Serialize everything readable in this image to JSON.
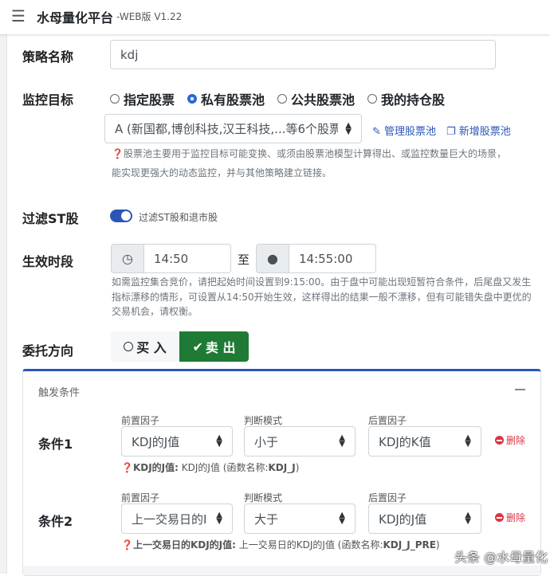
{
  "header": {
    "title": "水母量化平台",
    "version": "-WEB版 V1.22"
  },
  "form": {
    "name_label": "策略名称",
    "name_value": "kdj",
    "target_label": "监控目标",
    "target_options": [
      "指定股票",
      "私有股票池",
      "公共股票池",
      "我的持仓股"
    ],
    "target_selected": 1,
    "pool_select": "A (新国都,博创科技,汉王科技,...等6个股票",
    "manage_pool": "管理股票池",
    "new_pool": "新增股票池",
    "pool_help": [
      "股票池主要用于监控目标可能变换、或须由股票池模型计算得出、或监控数量巨大的场景，",
      "能实现更强大的动态监控，并与其他策略建立链接。"
    ],
    "st_label": "过滤ST股",
    "st_toggle_text": "过滤ST股和退市股",
    "st_on": true,
    "time_label": "生效时段",
    "time_start": "14:50",
    "time_sep": "至",
    "time_end": "14:55:00",
    "time_help": "如需监控集合竞价，请把起始时间设置到9:15:00。由于盘中可能出现短暂符合条件，后尾盘又发生指标漂移的情形，可设置从14:50开始生效，这样得出的结果一般不漂移，但有可能错失盘中更优的交易机会，请权衡。",
    "direction_label": "委托方向",
    "buy": "买 入",
    "sell": "卖 出",
    "direction_selected": "sell"
  },
  "trigger": {
    "title": "触发条件",
    "col_labels": [
      "前置因子",
      "判断模式",
      "后置因子"
    ],
    "delete_label": "删除",
    "conditions": [
      {
        "label": "条件1",
        "front": "KDJ的J值",
        "mode": "小于",
        "back": "KDJ的K值",
        "help_bold": "KDJ的J值:",
        "help_text": " KDJ的J值 (函数名称:",
        "help_fn": "KDJ_J",
        ")": ")"
      },
      {
        "label": "条件2",
        "front": "上一交易日的I",
        "mode": "大于",
        "back": "KDJ的J值",
        "help_bold": "上一交易日的KDJ的J值:",
        "help_text": " 上一交易日的KDJ的J值 (函数名称:",
        "help_fn": "KDJ_J_PRE"
      }
    ]
  },
  "watermark": "头条 @水母量化",
  "colors": {
    "accent": "#2a56b8",
    "sell_green": "#1f7a35",
    "danger": "#dc3545"
  }
}
